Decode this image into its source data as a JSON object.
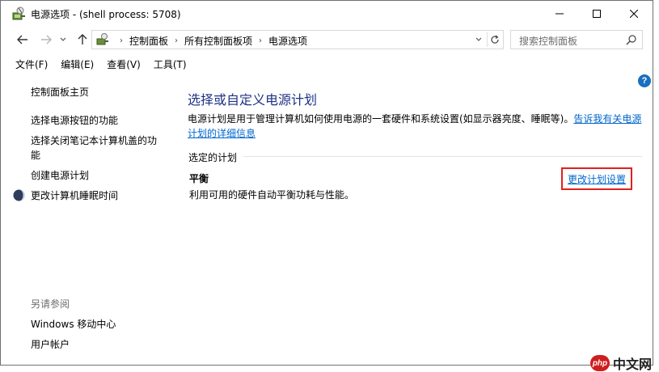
{
  "window": {
    "title": "电源选项 - (shell process: 5708)",
    "app_icon": "power-options-icon"
  },
  "address": {
    "crumbs": [
      "控制面板",
      "所有控制面板项",
      "电源选项"
    ],
    "search_placeholder": "搜索控制面板"
  },
  "menu": [
    "文件(F)",
    "编辑(E)",
    "查看(V)",
    "工具(T)"
  ],
  "left_pane": {
    "home": "控制面板主页",
    "links": [
      "选择电源按钮的功能",
      "选择关闭笔记本计算机盖的功",
      "能",
      "创建电源计划",
      "更改计算机睡眠时间"
    ],
    "see_also_label": "另请参阅",
    "see_also": [
      "Windows 移动中心",
      "用户帐户"
    ]
  },
  "main": {
    "title": "选择或自定义电源计划",
    "desc_line1": "电源计划是用于管理计算机如何使用电源的一套硬件和系统设置(如显示器亮度、睡眠等)。",
    "desc_link_a": "告诉我有关电源",
    "desc_link_b": "计划的详细信息",
    "group_label": "选定的计划",
    "plan_name": "平衡",
    "plan_desc": "利用可用的硬件自动平衡功耗与性能。",
    "change_link": "更改计划设置"
  },
  "watermark": {
    "badge": "php",
    "text": "中文网"
  },
  "colors": {
    "link": "#0066cc",
    "title": "#1e3287",
    "highlight_box": "#e0201e",
    "help": "#1a6fbf"
  }
}
